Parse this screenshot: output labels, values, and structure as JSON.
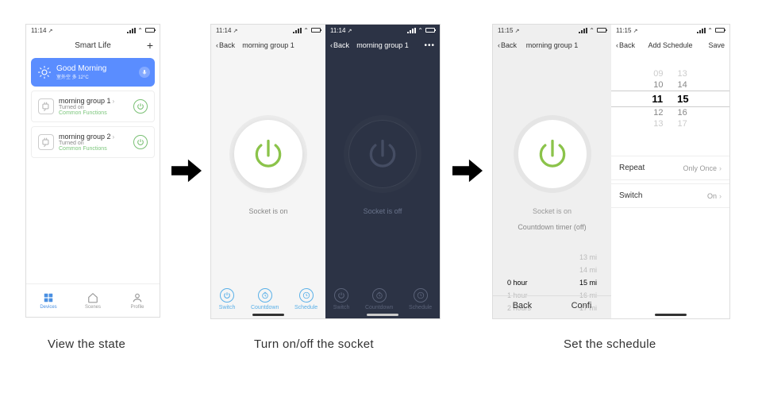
{
  "status": {
    "time1": "11:14",
    "time2": "11:15",
    "loc": "↗"
  },
  "home": {
    "title": "Smart Life",
    "banner_title": "Good Morning",
    "banner_sub": "室外空 多  12°C",
    "devices": [
      {
        "name": "morning group 1",
        "state": "Turned on",
        "func": "Common Functions"
      },
      {
        "name": "morning group 2",
        "state": "Turned on",
        "func": "Common Functions"
      }
    ],
    "tabs": [
      "Devices",
      "Scenes",
      "Profile"
    ]
  },
  "nav": {
    "back": "Back",
    "title": "morning group 1",
    "more": "•••",
    "save": "Save",
    "add_sched": "Add Schedule"
  },
  "socket": {
    "on": "Socket is on",
    "off": "Socket is off",
    "bottom": [
      "Switch",
      "Countdown",
      "Schedule"
    ]
  },
  "countdown": {
    "title": "Countdown timer (off)",
    "rows": [
      {
        "h": "",
        "m": "13 mi"
      },
      {
        "h": "",
        "m": "14 mi"
      },
      {
        "h": "0 hour",
        "m": "15 mi"
      },
      {
        "h": "1 hour",
        "m": "16 mi"
      },
      {
        "h": "2 hours",
        "m": "17 mi"
      }
    ],
    "actions": [
      "Back",
      "Confi"
    ]
  },
  "schedule": {
    "time_rows": [
      {
        "h": "09",
        "m": "13"
      },
      {
        "h": "10",
        "m": "14"
      },
      {
        "h": "11",
        "m": "15"
      },
      {
        "h": "12",
        "m": "16"
      },
      {
        "h": "13",
        "m": "17"
      }
    ],
    "repeat_label": "Repeat",
    "repeat_value": "Only Once",
    "switch_label": "Switch",
    "switch_value": "On"
  },
  "captions": {
    "c1": "View the state",
    "c2": "Turn on/off the socket",
    "c3": "Set the schedule"
  }
}
